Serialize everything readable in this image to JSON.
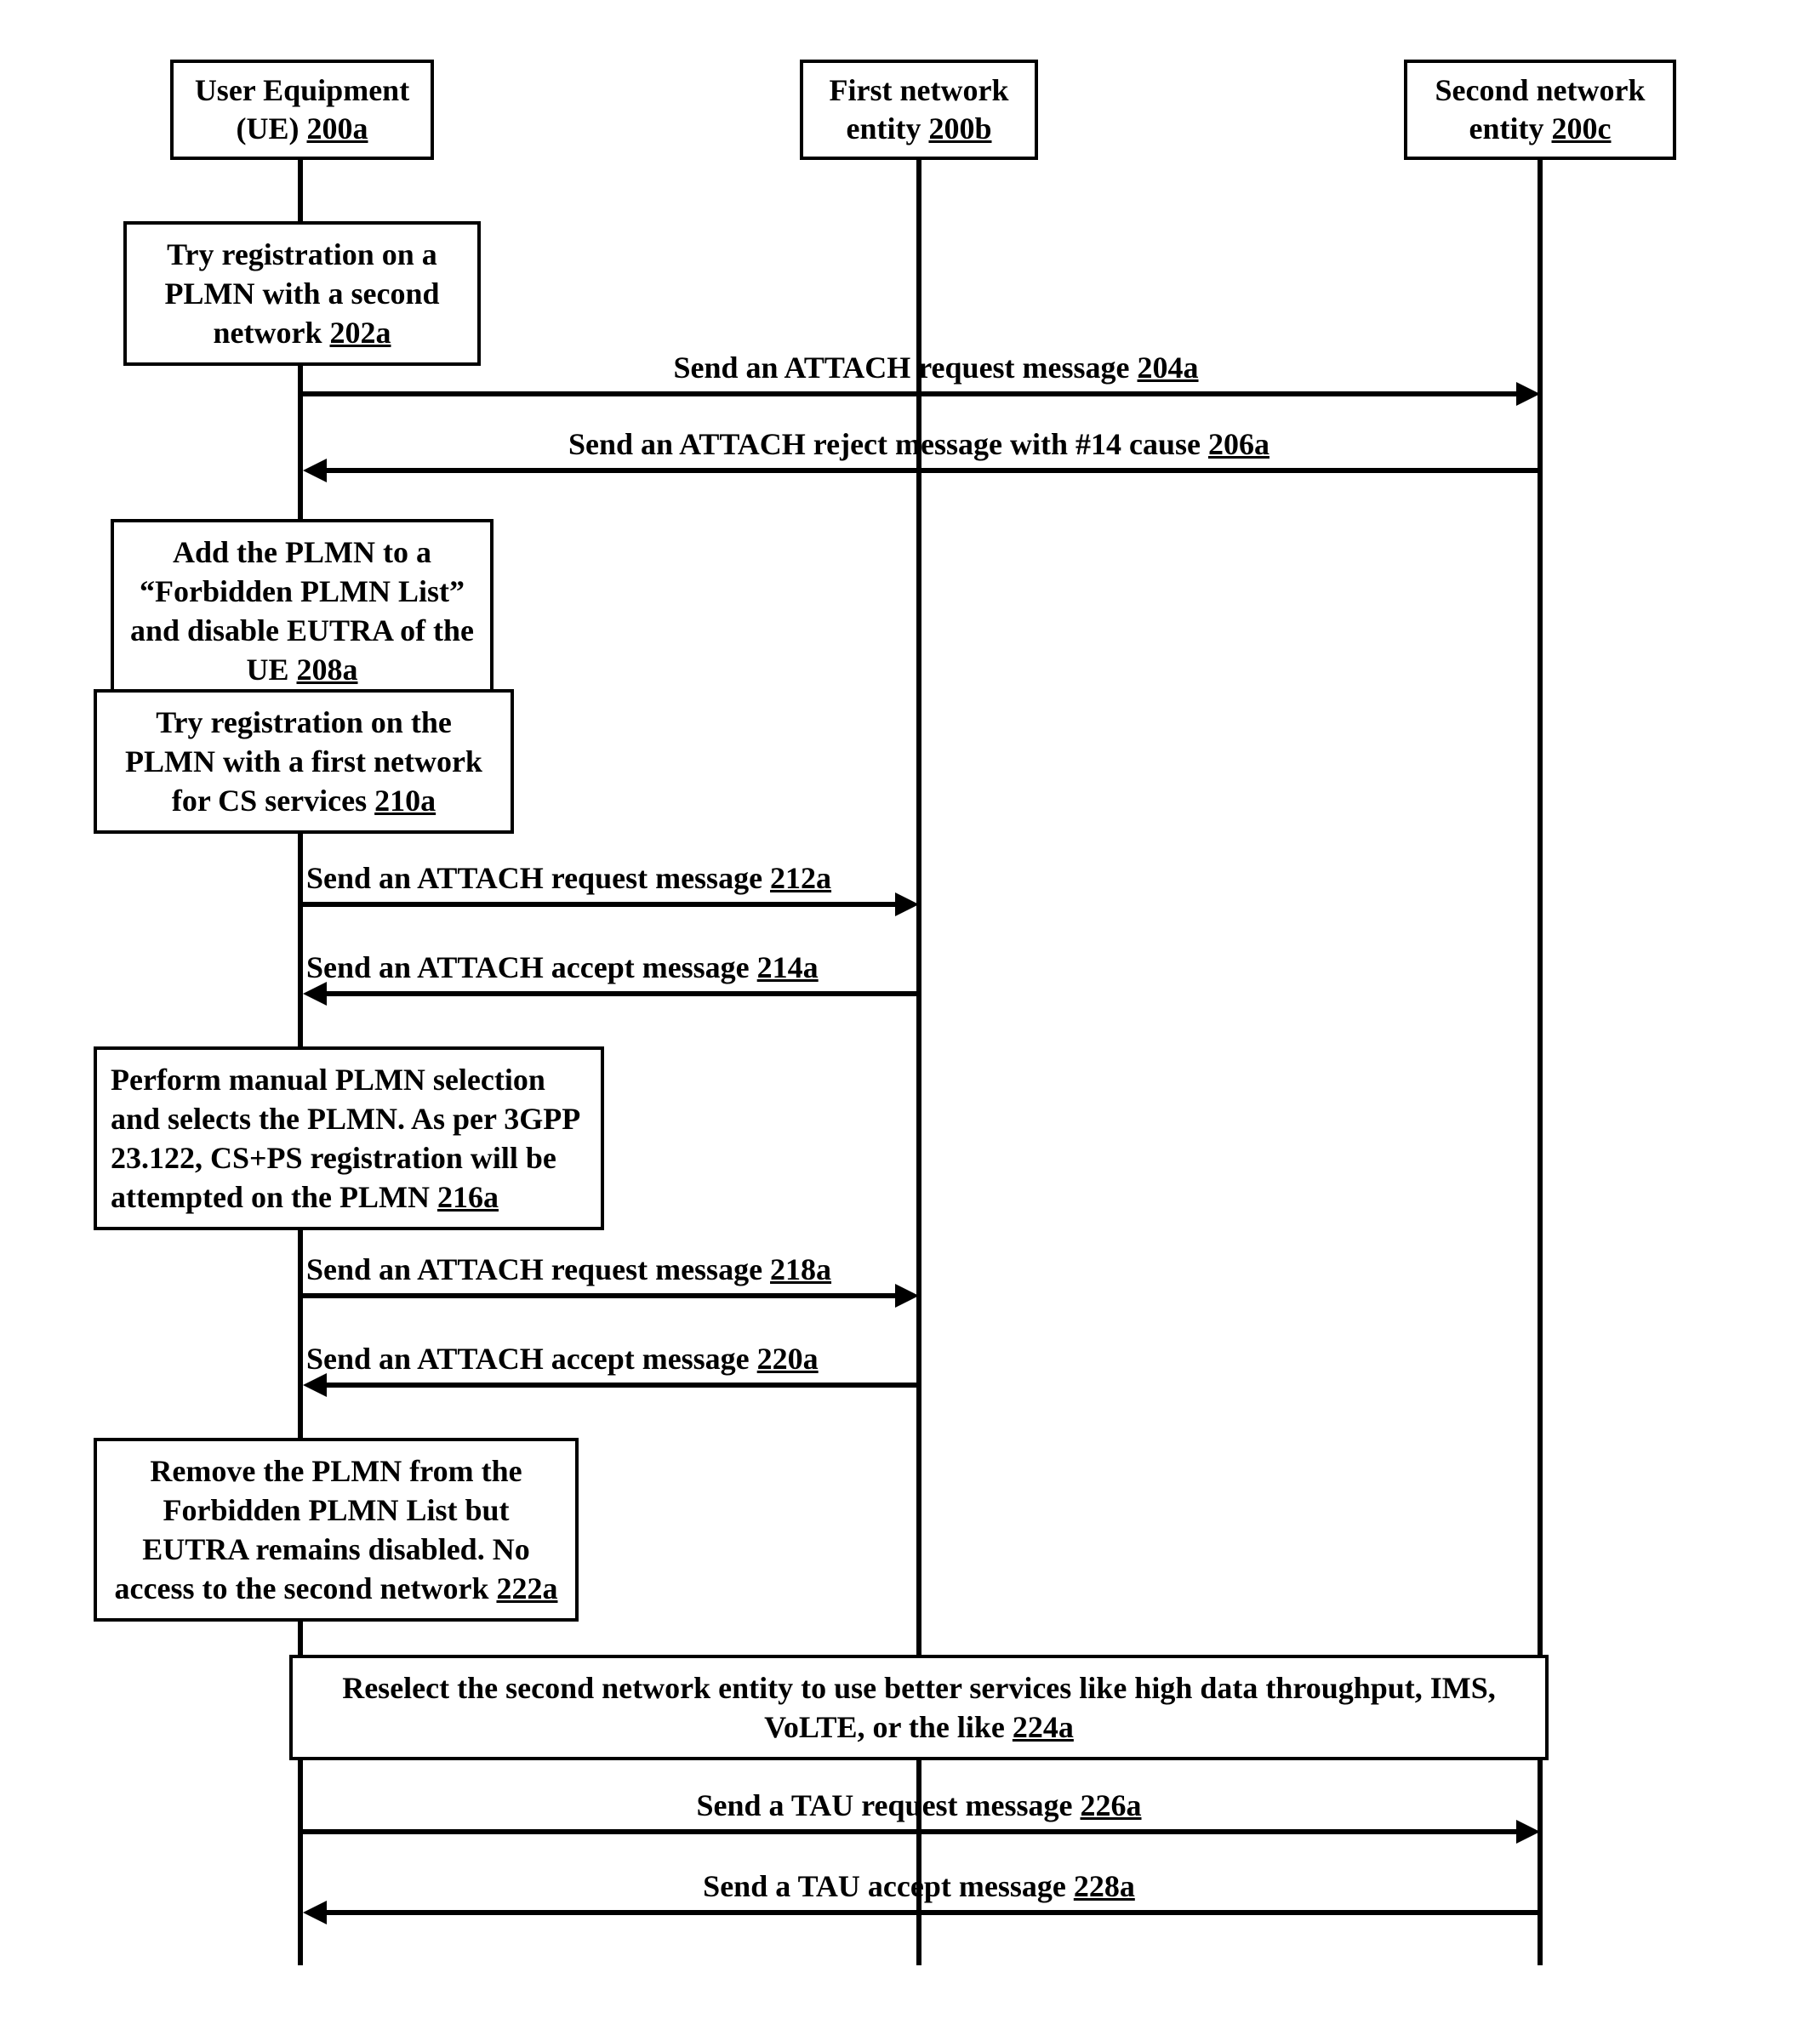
{
  "participants": {
    "ue": {
      "title": "User Equipment (UE) ",
      "ref": "200a"
    },
    "first": {
      "title": "First network entity ",
      "ref": "200b"
    },
    "second": {
      "title": "Second network entity ",
      "ref": "200c"
    }
  },
  "steps": {
    "s202a": {
      "text": "Try registration on a PLMN with a second network ",
      "ref": "202a"
    },
    "s208a": {
      "text": "Add the PLMN to a “Forbidden PLMN List” and disable EUTRA of the UE ",
      "ref": "208a"
    },
    "s210a": {
      "text": "Try registration on the PLMN with a first network for CS services ",
      "ref": "210a"
    },
    "s216a": {
      "text": "Perform manual PLMN selection and selects the PLMN. As per 3GPP 23.122, CS+PS registration will be attempted on the PLMN ",
      "ref": "216a"
    },
    "s222a": {
      "text": "Remove the PLMN from the Forbidden PLMN List but EUTRA remains disabled. No access to the second network ",
      "ref": "222a"
    },
    "s224a": {
      "text": "Reselect   the second network entity to use better services like high data throughput, IMS, VoLTE, or the like ",
      "ref": "224a"
    }
  },
  "messages": {
    "m204a": {
      "text": "Send an ATTACH request message ",
      "ref": "204a"
    },
    "m206a": {
      "text": "Send an ATTACH reject message with #14 cause ",
      "ref": "206a"
    },
    "m212a": {
      "text": "Send an ATTACH request message ",
      "ref": "212a"
    },
    "m214a": {
      "text": "Send an ATTACH accept message ",
      "ref": "214a"
    },
    "m218a": {
      "text": "Send an ATTACH request message ",
      "ref": "218a"
    },
    "m220a": {
      "text": "Send an ATTACH accept message ",
      "ref": "220a"
    },
    "m226a": {
      "text": "Send a TAU request message ",
      "ref": "226a"
    },
    "m228a": {
      "text": "Send a TAU accept message ",
      "ref": "228a"
    }
  }
}
